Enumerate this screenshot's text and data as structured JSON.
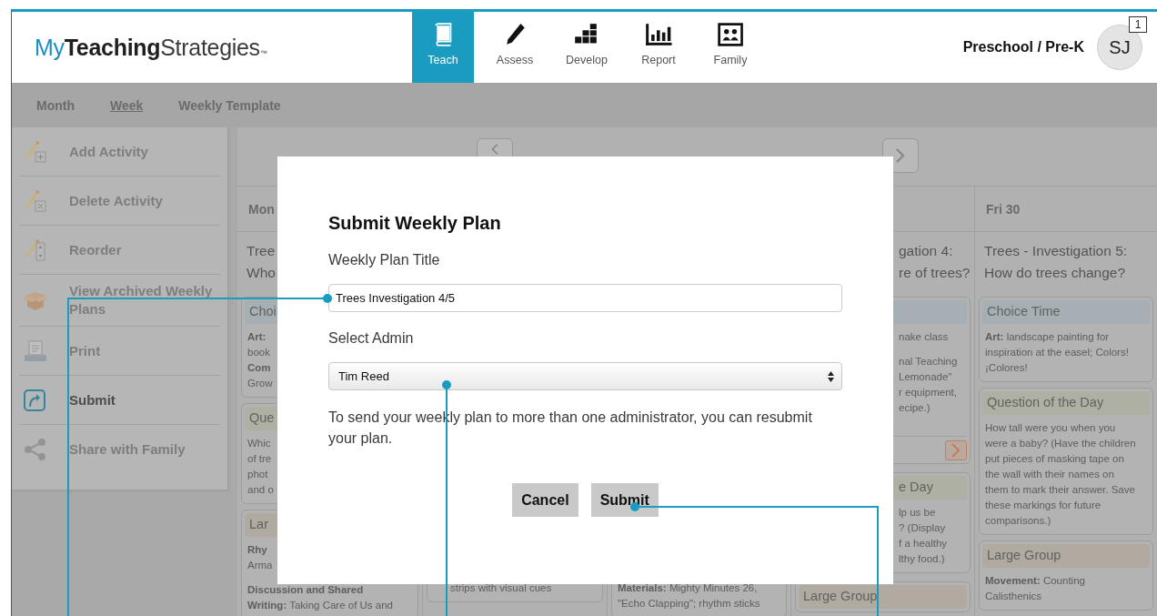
{
  "header": {
    "logo": {
      "prefix": "My",
      "name": "Teaching",
      "suffix": "Strategies",
      "mark": "™"
    },
    "tabs": [
      {
        "label": "Teach",
        "selected": true
      },
      {
        "label": "Assess",
        "selected": false
      },
      {
        "label": "Develop",
        "selected": false
      },
      {
        "label": "Report",
        "selected": false
      },
      {
        "label": "Family",
        "selected": false
      }
    ],
    "program": "Preschool / Pre-K",
    "avatar": {
      "initials": "SJ",
      "badge": "1"
    }
  },
  "view_tabs": [
    {
      "label": "Month",
      "selected": false
    },
    {
      "label": "Week",
      "selected": true
    },
    {
      "label": "Weekly Template",
      "selected": false
    }
  ],
  "sidebar": {
    "items": [
      {
        "label": "Add Activity",
        "disabled": true
      },
      {
        "label": "Delete Activity",
        "disabled": true
      },
      {
        "label": "Reorder",
        "disabled": true
      },
      {
        "label": "View Archived Weekly Plans",
        "disabled": true
      },
      {
        "label": "Print",
        "disabled": true
      },
      {
        "label": "Submit",
        "disabled": false
      },
      {
        "label": "Share with Family",
        "disabled": true
      }
    ]
  },
  "calendar": {
    "columns": [
      {
        "header": "Mon",
        "title_lines": [
          "Tree",
          "Who"
        ],
        "cards": [
          {
            "kind": "choice",
            "heading": "Choi",
            "paragraphs": [
              [
                "**Art:**",
                "book",
                "**Com**",
                "Grow"
              ]
            ]
          },
          {
            "kind": "question",
            "heading": "Que",
            "paragraphs": [
              [
                "Whic",
                "of tre",
                "phot",
                "and o"
              ]
            ]
          },
          {
            "kind": "large",
            "heading": "Lar",
            "paragraphs": [
              [
                "**Rhy**",
                "Arma"
              ],
              [
                "**Discussion and Shared**",
                "**Writing:** Taking Care of Us and"
              ]
            ]
          }
        ]
      },
      {
        "cards": [
          {
            "kind": "plain",
            "paragraphs": [
              [
                "strips with visual cues"
              ]
            ]
          }
        ]
      },
      {
        "cards": [
          {
            "kind": "plain",
            "paragraphs": [
              [
                "**Materials:** Mighty Minutes 26,",
                "\"Echo Clapping\"; rhythm sticks"
              ]
            ]
          }
        ]
      },
      {
        "title_lines": [
          "gation 4:",
          "re of trees?"
        ],
        "cards": [
          {
            "kind": "choice",
            "paragraphs": [
              [
                "nake class"
              ],
              [
                "nal Teaching",
                "Lemonade\"",
                "r equipment,",
                "ecipe.)"
              ]
            ],
            "next_button": true
          },
          {
            "kind": "question",
            "heading": "e Day",
            "paragraphs": [
              [
                "lp us be",
                "? (Display",
                "f a healthy",
                "lthy food.)"
              ]
            ]
          },
          {
            "kind": "large",
            "heading": "Large Group"
          }
        ]
      },
      {
        "header": "Fri 30",
        "title_lines": [
          "Trees - Investigation 5:",
          "How do trees change?"
        ],
        "cards": [
          {
            "kind": "choice",
            "heading": "Choice Time",
            "paragraphs": [
              [
                "**Art:** landscape painting for",
                "inspiration at the easel; Colors!",
                "¡Colores!"
              ]
            ]
          },
          {
            "kind": "question",
            "heading": "Question of the Day",
            "paragraphs": [
              [
                "How tall were you when you",
                "were a baby? (Have the children",
                "put pieces of masking tape on",
                "the wall with their names on",
                "them to mark their answer. Save",
                "these markings for future",
                "comparisons.)"
              ]
            ]
          },
          {
            "kind": "large",
            "heading": "Large Group",
            "paragraphs": [
              [
                "**Movement:** Counting",
                "Calisthenics"
              ]
            ]
          }
        ]
      }
    ]
  },
  "dialog": {
    "title": "Submit Weekly Plan",
    "title_label": "Weekly Plan Title",
    "title_value": "Trees Investigation 4/5",
    "admin_label": "Select Admin",
    "admin_value": "Tim Reed",
    "note": "To send your weekly plan to more than one administrator, you can resubmit your plan.",
    "buttons": [
      {
        "label": "Cancel"
      },
      {
        "label": "Submit"
      }
    ]
  }
}
